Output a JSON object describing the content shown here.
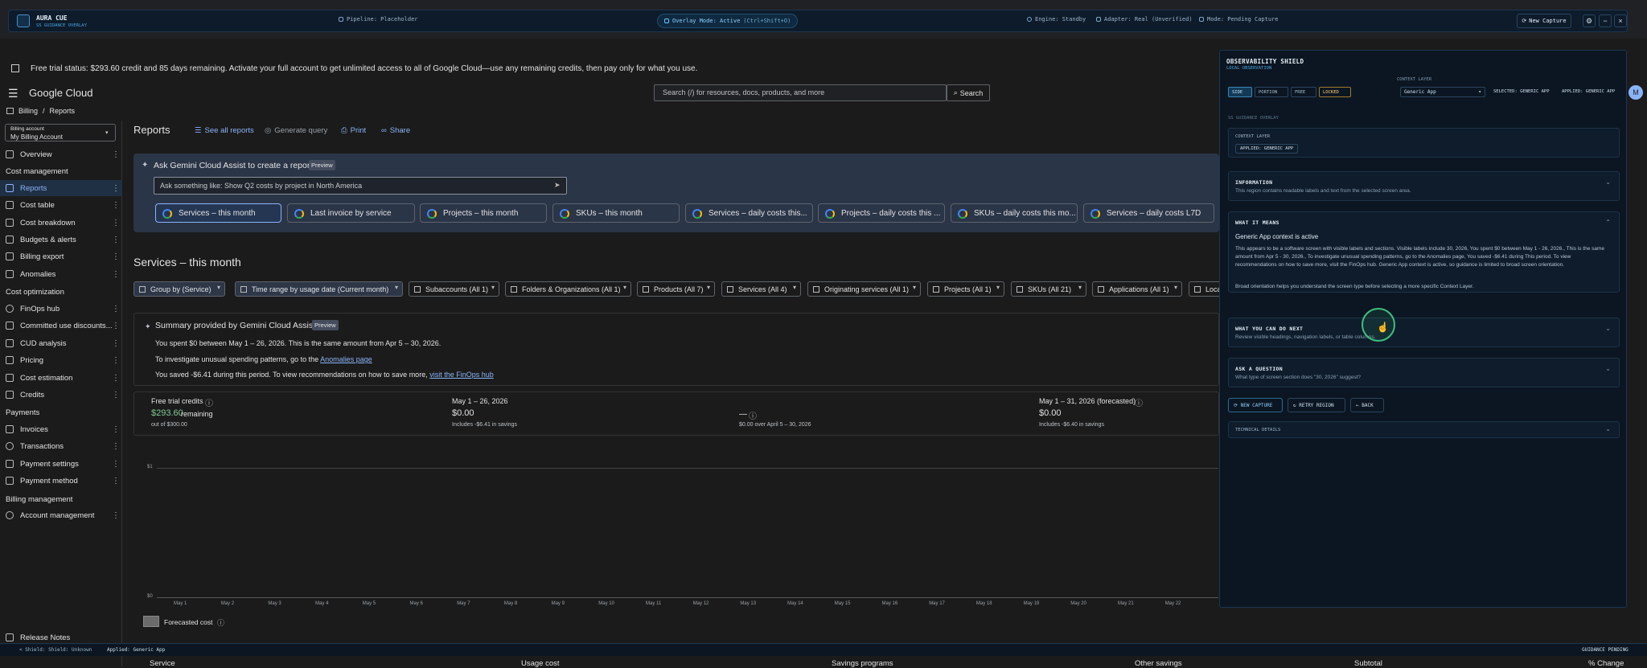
{
  "overlay_bar": {
    "app_name": "AURA CUE",
    "app_sub": "SS GUIDANCE OVERLAY",
    "pipeline": "Pipeline: Placeholder",
    "overlay_mode": "Overlay Mode: Active",
    "overlay_hotkey": "(Ctrl+Shift+O)",
    "engine": "Engine: Standby",
    "adapter": "Adapter: Real (Unverified)",
    "mode": "Mode: Pending Capture",
    "new_capture": "New Capture"
  },
  "banner": {
    "text": "Free trial status: $293.60 credit and 85 days remaining. Activate your full account to get unlimited access to all of Google Cloud—use any remaining credits, then pay only for what you use."
  },
  "header": {
    "logo": "Google Cloud",
    "search_placeholder": "Search (/) for resources, docs, products, and more",
    "search_button": "Search",
    "avatar": "M"
  },
  "breadcrumb": {
    "billing": "Billing",
    "sep": "/",
    "reports": "Reports"
  },
  "billing_account": {
    "label": "Billing account",
    "value": "My Billing Account"
  },
  "sidebar": {
    "overview": "Overview",
    "cost_management": "Cost management",
    "reports": "Reports",
    "cost_table": "Cost table",
    "cost_breakdown": "Cost breakdown",
    "budgets": "Budgets & alerts",
    "billing_export": "Billing export",
    "anomalies": "Anomalies",
    "cost_optimization": "Cost optimization",
    "finops": "FinOps hub",
    "committed": "Committed use discounts...",
    "cud": "CUD analysis",
    "pricing": "Pricing",
    "cost_estimation": "Cost estimation",
    "credits": "Credits",
    "payments": "Payments",
    "invoices": "Invoices",
    "transactions": "Transactions",
    "payment_settings": "Payment settings",
    "payment_method": "Payment method",
    "billing_management": "Billing management",
    "account_management": "Account management",
    "release_notes": "Release Notes"
  },
  "toolbar": {
    "title": "Reports",
    "see_all": "See all reports",
    "generate": "Generate query",
    "print": "Print",
    "share": "Share"
  },
  "gemini": {
    "title": "Ask Gemini Cloud Assist to create a report",
    "badge": "Preview",
    "input_placeholder": "Ask something like: Show Q2 costs by project in North America",
    "chips": [
      "Services – this month",
      "Last invoice by service",
      "Projects – this month",
      "SKUs – this month",
      "Services – daily costs this...",
      "Projects – daily costs this ...",
      "SKUs – daily costs this mo...",
      "Services – daily costs L7D"
    ]
  },
  "report": {
    "title": "Services – this month",
    "filters": [
      "Group by (Service)",
      "Time range by usage date (Current month)",
      "Subaccounts (All 1)",
      "Folders & Organizations (All 1)",
      "Products (All 7)",
      "Services (All 4)",
      "Originating services (All 1)",
      "Projects (All 1)",
      "SKUs (All 21)",
      "Applications (All 1)",
      "Locatio"
    ]
  },
  "summary": {
    "title": "Summary provided by Gemini Cloud Assist",
    "badge": "Preview",
    "line1": "You spent $0 between May 1 – 26, 2026. This is the same amount from Apr 5 – 30, 2026.",
    "line2_pre": "To investigate unusual spending patterns, go to the",
    "line2_link": "Anomalies page",
    "line3_pre": "You saved -$6.41 during this period. To view recommendations on how to save more,",
    "line3_link": "visit the FinOps hub"
  },
  "stats": {
    "credits_label": "Free trial credits",
    "credits_value": "$293.60",
    "credits_remaining": "remaining",
    "credits_of": "out of $300.00",
    "period_label": "May 1 – 26, 2026",
    "period_value": "$0.00",
    "period_savings": "Includes -$6.41 in savings",
    "compare_value": "—",
    "compare_sub": "$0.00 over April 5 – 30, 2026",
    "forecast_label": "May 1 – 31, 2026 (forecasted)",
    "forecast_value": "$0.00",
    "forecast_savings": "Includes -$6.40 in savings"
  },
  "chart": {
    "y_top": "$1",
    "y_bottom": "$0",
    "legend": "Forecasted cost",
    "x_ticks": [
      "May 1",
      "May 2",
      "May 3",
      "May 4",
      "May 5",
      "May 6",
      "May 7",
      "May 8",
      "May 9",
      "May 10",
      "May 11",
      "May 12",
      "May 13",
      "May 14",
      "May 15",
      "May 16",
      "May 17",
      "May 18",
      "May 19",
      "May 20",
      "May 21",
      "May 22"
    ]
  },
  "table_headers": {
    "service": "Service",
    "usage_cost": "Usage cost",
    "savings_programs": "Savings programs",
    "other_savings": "Other savings",
    "subtotal": "Subtotal",
    "pct_change": "% Change"
  },
  "statusbar": {
    "left": "< Shield: Shield: Unknown",
    "applied": "Applied: Generic App",
    "right": "GUIDANCE PENDING"
  },
  "shield": {
    "title": "OBSERVABILITY SHIELD",
    "subtitle": "LOCAL OBSERVATION",
    "context_layer_label": "CONTEXT LAYER",
    "context_select": "Generic App",
    "selected": "SELECTED: GENERIC APP",
    "applied_top": "APPLIED: GENERIC APP",
    "modes": [
      "SIDE",
      "PORTION",
      "FREE",
      "LOCKED"
    ],
    "section_label": "SS GUIDANCE OVERLAY",
    "context_card_label": "CONTEXT LAYER",
    "context_card_applied": "APPLIED: GENERIC APP",
    "info_title": "INFORMATION",
    "info_text": "This region contains readable labels and text from the selected screen area.",
    "means_title": "WHAT IT MEANS",
    "means_head": "Generic App context is active",
    "means_text": "This appears to be a software screen with visible labels and sections. Visible labels include 30, 2026, You spent $0 between May 1 - 26, 2026., This is the same amount from Apr 5 - 30, 2026., To investigate unusual spending patterns, go to the Anomalies page, You saved -$6.41 during This period. To view recommendations on how to save more, visit the FinOps hub. Generic App context is active, so guidance is limited to broad screen orientation.",
    "means_note": "Broad orientation helps you understand the screen type before selecting a more specific Context Layer.",
    "next_title": "WHAT YOU CAN DO NEXT",
    "next_text": "Review visible headings, navigation labels, or table columns.",
    "ask_title": "ASK A QUESTION",
    "ask_text": "What type of screen section does \"30, 2026\" suggest?",
    "btn_new": "NEW CAPTURE",
    "btn_retry": "RETRY REGION",
    "btn_back": "BACK",
    "tech_title": "TECHNICAL DETAILS"
  }
}
